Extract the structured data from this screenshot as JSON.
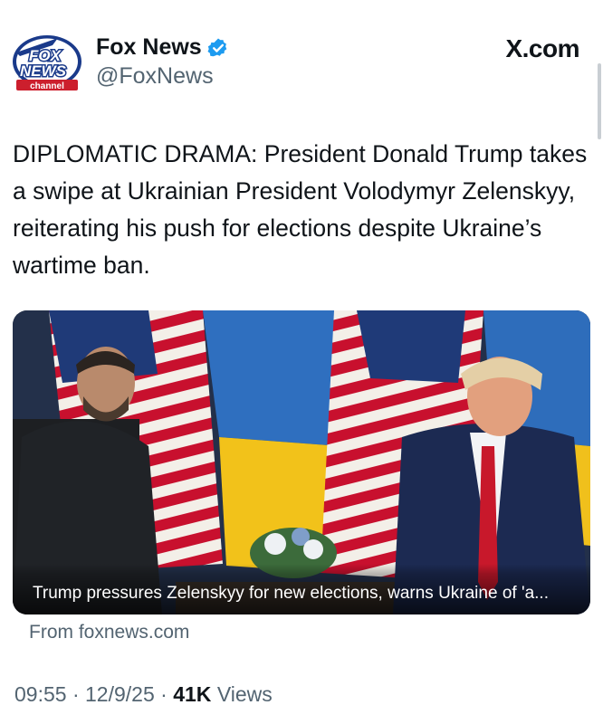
{
  "account": {
    "name": "Fox News",
    "handle": "@FoxNews",
    "logo_line1": "FOX",
    "logo_line2": "NEWS",
    "logo_line3": "channel"
  },
  "site": "X.com",
  "tweet": {
    "text": "DIPLOMATIC DRAMA: President Donald Trump takes a swipe at Ukrainian President Volodymyr Zelenskyy, reiterating his push for elections despite Ukraine’s wartime ban."
  },
  "card": {
    "caption": "Trump pressures Zelenskyy for new elections, warns Ukraine of 'a...",
    "source": "From foxnews.com"
  },
  "meta": {
    "time": "09:55",
    "date": "12/9/25",
    "views_count": "41K",
    "views_label": "Views"
  },
  "colors": {
    "text": "#0f1419",
    "muted": "#536471",
    "verified": "#1d9bf0",
    "fox_blue": "#1a3a8a",
    "fox_red": "#cc1f2d"
  }
}
